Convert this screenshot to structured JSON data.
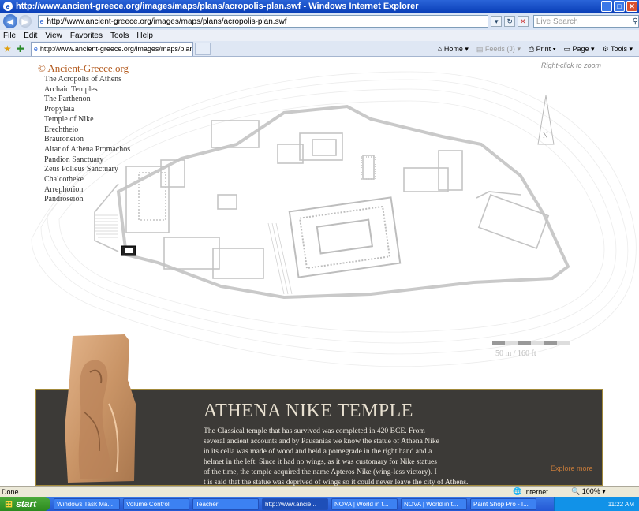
{
  "window": {
    "title": "http://www.ancient-greece.org/images/maps/plans/acropolis-plan.swf - Windows Internet Explorer"
  },
  "address": {
    "url": "http://www.ancient-greece.org/images/maps/plans/acropolis-plan.swf",
    "search_placeholder": "Live Search"
  },
  "menu": [
    "File",
    "Edit",
    "View",
    "Favorites",
    "Tools",
    "Help"
  ],
  "tab": {
    "label": "http://www.ancient-greece.org/images/maps/plans/a..."
  },
  "toolbar": {
    "home": "Home",
    "feeds": "Feeds (J)",
    "print": "Print",
    "page": "Page",
    "tools": "Tools"
  },
  "page": {
    "brand": "© Ancient-Greece.org",
    "zoom_hint": "Right-click to zoom",
    "nav": [
      "The Acropolis of Athens",
      "Archaic Temples",
      "The Parthenon",
      "Propylaia",
      "Temple of Nike",
      "Erechtheio",
      "Brauroneion",
      "Altar of Athena Promachos",
      "Pandion Sanctuary",
      "Zeus Polieus Sanctuary",
      "Chalcotheke",
      "Arrephorion",
      "Pandroseion"
    ],
    "north": "N",
    "scale": "50 m / 160 ft",
    "info": {
      "title": "ATHENA NIKE TEMPLE",
      "lines": [
        "The Classical temple that has survived was completed in 420 BCE. From",
        "several ancient accounts and by Pausanias we know the statue of Athena Nike",
        "in its cella was made of wood and held a pomegrade in the right hand and a",
        "helmet in the left. Since it had no wings, as it was customary for Nike statues",
        "of the time, the temple acquired the name Apteros Nike (wing-less victory). I",
        "t is said that the statue was deprived of wings so it could never leave the city of Athens."
      ],
      "explore": "Explore more"
    }
  },
  "status": {
    "left": "Done",
    "zone": "Internet",
    "zoom": "100%"
  },
  "taskbar": {
    "start": "start",
    "buttons": [
      "Windows Task Ma...",
      "Volume Control",
      "Teacher",
      "http://www.ancie...",
      "NOVA | World in t...",
      "NOVA | World in t...",
      "Paint Shop Pro - I..."
    ],
    "time": "11:22 AM"
  },
  "colors": {
    "brand": "#b35a1e",
    "panel": "#3c3a37",
    "explore": "#c77b3a",
    "titlebar": "#0a3fb8"
  }
}
